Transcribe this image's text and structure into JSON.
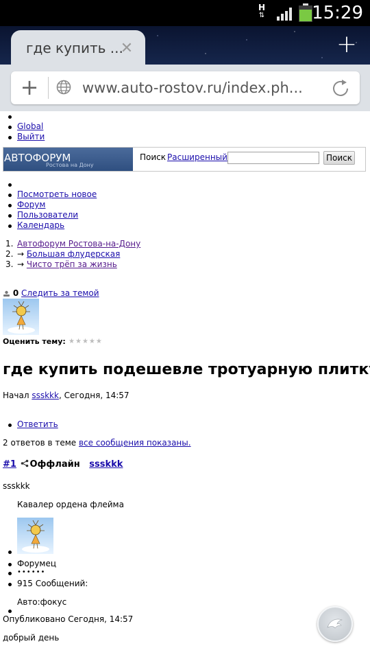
{
  "status_bar": {
    "network_type": "H",
    "time": "15:29",
    "colors": {
      "battery": "#7ac943",
      "background": "#000000"
    }
  },
  "browser": {
    "tab_title": "где купить ...",
    "url": "www.auto-rostov.ru/index.ph..."
  },
  "page": {
    "top_links": [
      "",
      "Global",
      "Выйти"
    ],
    "logo": {
      "title": "АВТОФОРУМ",
      "subtitle": "Ростова на Дону"
    },
    "search": {
      "label": "Поиск",
      "advanced_link": "Расширенный",
      "input_value": "",
      "button_label": "Поиск"
    },
    "nav_links": [
      "",
      "Посмотреть новое",
      "Форум",
      "Пользователи",
      "Календарь"
    ],
    "breadcrumbs": [
      {
        "num": "1.",
        "arrow": "",
        "label": "Автофорум Ростова-на-Дону"
      },
      {
        "num": "2.",
        "arrow": "→",
        "label": "Большая флудерская"
      },
      {
        "num": "3.",
        "arrow": "→",
        "label": "Чисто трёп за жизнь"
      }
    ],
    "follow": {
      "count": "0",
      "label": "Следить за темой"
    },
    "rate_label": "Оценить тему:",
    "topic_title": "где купить подешевле тротуарную плитку",
    "started": {
      "prefix": "Начал",
      "author": "ssskkk",
      "when": ", Сегодня, 14:57"
    },
    "reply_label": "Ответить",
    "answers": {
      "text": "2 ответов в теме",
      "link": "все сообщения показаны."
    },
    "post": {
      "number": "#1",
      "status": "Оффлайн",
      "author_link": "ssskkk",
      "author_name": "ssskkk",
      "rank": "Кавалер ордена флейма",
      "group": "Форумец",
      "pips": "••••••",
      "messages": "915 Сообщений:",
      "car": "Авто:фокус",
      "published": "Опубликовано Сегодня, 14:57",
      "body": "добрый день"
    }
  }
}
